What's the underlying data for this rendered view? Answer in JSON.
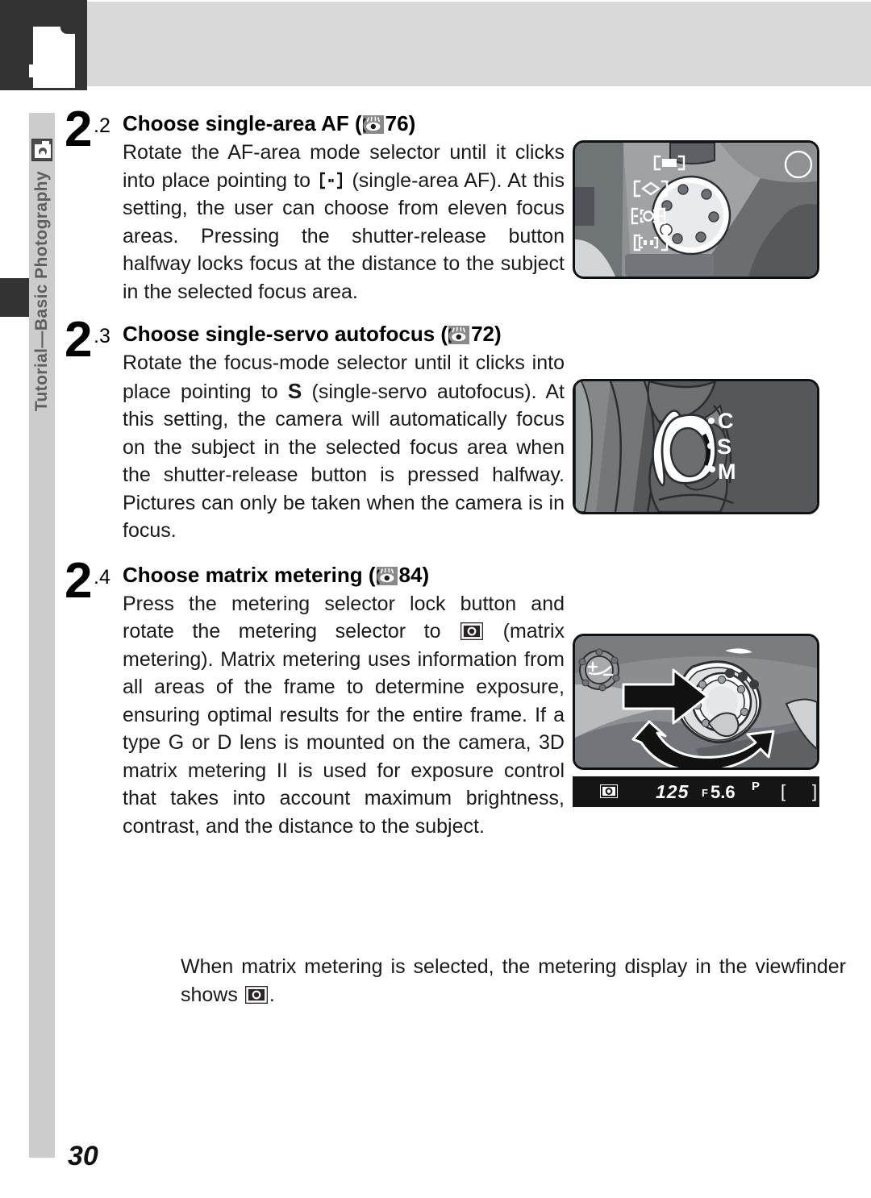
{
  "page": {
    "number": "30",
    "sidebar_label": "Tutorial—Basic Photography",
    "sidebar_icon": "camera-icon",
    "header_icon": "page-corner-glyph"
  },
  "steps": [
    {
      "number": "2",
      "sub": ".2",
      "title_prefix": "Choose single-area AF (",
      "title_ref_icon": "eye-reference-icon",
      "title_page": "76",
      "title_suffix": ")",
      "title_full": "Choose single-area AF ( 76)",
      "body_part1": "Rotate the AF-area mode selector until it clicks into place pointing to ",
      "body_inline_icon": "single-area-af-bracket-icon",
      "body_part2": " (single-area AF).  At this setting, the user can choose from eleven focus areas.  Pressing the shutter-release button halfway locks focus at the distance to the subject in the selected focus area.",
      "figure": {
        "name": "af-area-mode-selector-photo",
        "caption_icons": [
          "closest-subject",
          "dynamic-area",
          "group-dynamic",
          "single-area"
        ]
      }
    },
    {
      "number": "2",
      "sub": ".3",
      "title_prefix": "Choose single-servo autofocus (",
      "title_ref_icon": "eye-reference-icon",
      "title_page": "72",
      "title_suffix": ")",
      "title_full": "Choose single-servo autofocus ( 72)",
      "body_part1": "Rotate the focus-mode selector until it clicks into place pointing to ",
      "body_inline_icon": "letter-S",
      "body_inline_letter": "S",
      "body_part2": " (single-servo autofocus).  At this setting, the camera will automatically focus on the subject in the selected focus area when the shutter-release button is pressed halfway.  Pictures can only be taken when the camera is in focus.",
      "figure": {
        "name": "focus-mode-selector-photo",
        "labels": [
          "C",
          "S",
          "M"
        ]
      }
    },
    {
      "number": "2",
      "sub": ".4",
      "title_prefix": "Choose matrix metering (",
      "title_ref_icon": "eye-reference-icon",
      "title_page": "84",
      "title_suffix": ")",
      "title_full": "Choose matrix metering ( 84)",
      "body_part1": "Press the metering selector lock button and rotate the metering selector to ",
      "body_inline_icon": "matrix-metering-icon",
      "body_part2": " (matrix metering).  Matrix metering uses information from all areas of the frame to determine exposure, ensuring optimal results for the entire frame.  If a type G or D lens is mounted on the camera, 3D matrix metering II is used for exposure control that takes into account maximum brightness, contrast, and the distance to the subject.",
      "figure": {
        "name": "metering-selector-photo"
      }
    }
  ],
  "closing": {
    "part1": "When matrix metering is selected, the metering display in the viewfinder shows ",
    "inline_icon": "matrix-metering-icon",
    "part2": "."
  },
  "viewfinder_display": {
    "metering_icon": "matrix-metering-icon",
    "shutter_speed": "125",
    "aperture_prefix": "F",
    "aperture": "5.6",
    "exposure_mode": "P",
    "frame_bracket_left": "[",
    "frame_bracket_right": "]"
  },
  "colors": {
    "header_dark": "#333333",
    "header_gray": "#d9d9d9",
    "sidebar_gray": "#cccccc",
    "sidebar_text": "#5e5e5e",
    "figure_border": "#111111",
    "lcd_background": "#151515"
  }
}
